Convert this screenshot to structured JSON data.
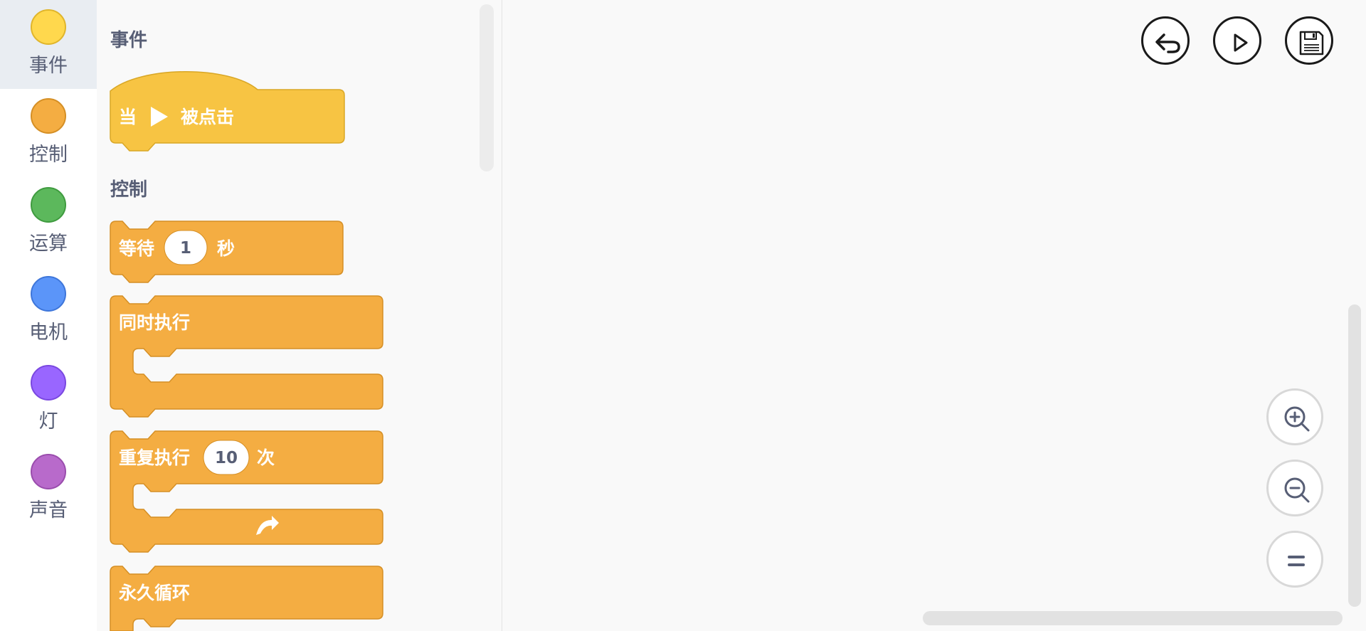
{
  "categories": [
    {
      "label": "事件",
      "color": "#ffd84d",
      "stroke": "#e0b52b"
    },
    {
      "label": "控制",
      "color": "#f4ad42",
      "stroke": "#d58f25"
    },
    {
      "label": "运算",
      "color": "#5cb85c",
      "stroke": "#3f9b3f"
    },
    {
      "label": "电机",
      "color": "#5b95f9",
      "stroke": "#3e76da"
    },
    {
      "label": "灯",
      "color": "#9966ff",
      "stroke": "#7a48e0"
    },
    {
      "label": "声音",
      "color": "#b86acb",
      "stroke": "#9a4dad"
    }
  ],
  "flyout": {
    "sections": {
      "events": "事件",
      "control": "控制"
    },
    "blocks": {
      "when_clicked": {
        "prefix": "当",
        "suffix": "被点击"
      },
      "wait": {
        "prefix": "等待",
        "value": "1",
        "suffix": "秒"
      },
      "parallel": {
        "label": "同时执行"
      },
      "repeat": {
        "prefix": "重复执行",
        "value": "10",
        "suffix": "次"
      },
      "forever": {
        "label": "永久循环"
      }
    }
  },
  "colors": {
    "event_block": "#f7c443",
    "event_block_stroke": "#d9a726",
    "control_block": "#f4ad42",
    "control_block_stroke": "#d58f25"
  }
}
